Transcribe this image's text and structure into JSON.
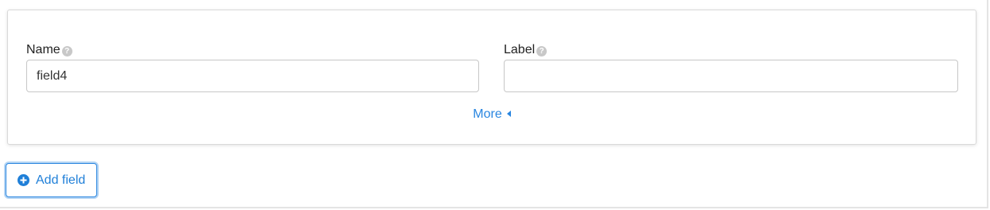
{
  "card": {
    "name_field": {
      "label": "Name",
      "value": "field4"
    },
    "label_field": {
      "label": "Label",
      "value": ""
    },
    "more_label": "More"
  },
  "add_field_label": "Add field",
  "icons": {
    "help": "question-circle-icon",
    "more": "caret-left-icon",
    "add": "plus-circle-icon"
  },
  "colors": {
    "accent": "#2a86e0",
    "help_icon": "#c8c8c8"
  }
}
